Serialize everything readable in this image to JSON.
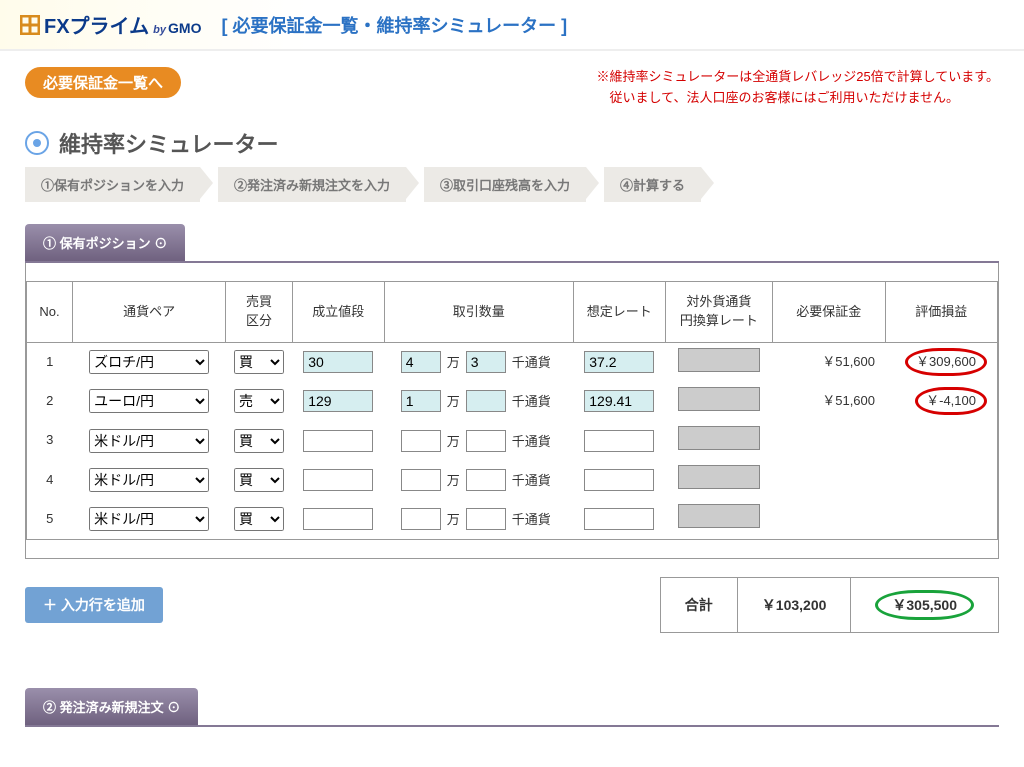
{
  "header": {
    "brand_main": "FXプライム",
    "brand_by": "by",
    "brand_gmo": "GMO",
    "title": "[ 必要保証金一覧・維持率シミュレーター ]"
  },
  "top_pill": "必要保証金一覧へ",
  "warning_line1": "※維持率シミュレーターは全通貨レバレッジ25倍で計算しています。",
  "warning_line2": "　従いまして、法人口座のお客様にはご利用いただけません。",
  "section_title": "維持率シミュレーター",
  "steps": [
    "①保有ポジションを入力",
    "②発注済み新規注文を入力",
    "③取引口座残高を入力",
    "④計算する"
  ],
  "tab1_label": "① 保有ポジション ⊙",
  "tab2_label": "② 発注済み新規注文 ⊙",
  "columns": {
    "no": "No.",
    "pair": "通貨ペア",
    "side": "売買\n区分",
    "price": "成立値段",
    "qty": "取引数量",
    "rate": "想定レート",
    "fxrate": "対外貨通貨\n円換算レート",
    "margin": "必要保証金",
    "pl": "評価損益"
  },
  "units": {
    "man": "万",
    "sen": "千通貨"
  },
  "rows": [
    {
      "no": "1",
      "pair": "ズロチ/円",
      "side": "買",
      "price": "30",
      "qman": "4",
      "qsen": "3",
      "rate": "37.2",
      "margin": "￥51,600",
      "pl": "￥309,600"
    },
    {
      "no": "2",
      "pair": "ユーロ/円",
      "side": "売",
      "price": "129",
      "qman": "1",
      "qsen": "",
      "rate": "129.41",
      "margin": "￥51,600",
      "pl": "￥-4,100"
    },
    {
      "no": "3",
      "pair": "米ドル/円",
      "side": "買",
      "price": "",
      "qman": "",
      "qsen": "",
      "rate": "",
      "margin": "",
      "pl": ""
    },
    {
      "no": "4",
      "pair": "米ドル/円",
      "side": "買",
      "price": "",
      "qman": "",
      "qsen": "",
      "rate": "",
      "margin": "",
      "pl": ""
    },
    {
      "no": "5",
      "pair": "米ドル/円",
      "side": "買",
      "price": "",
      "qman": "",
      "qsen": "",
      "rate": "",
      "margin": "",
      "pl": ""
    }
  ],
  "add_row_label": "＋ 入力行を追加",
  "totals": {
    "label": "合計",
    "margin": "￥103,200",
    "pl": "￥305,500"
  }
}
